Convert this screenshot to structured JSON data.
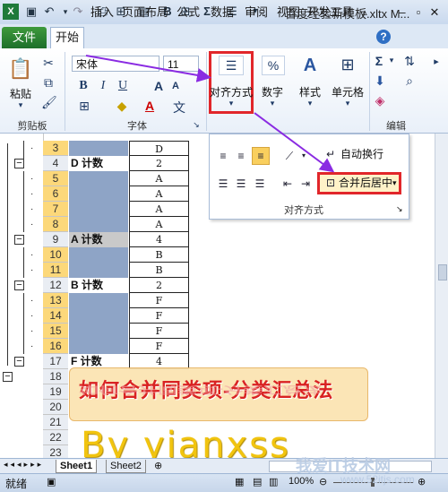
{
  "window": {
    "title": "百度经验新模板.xltx M..."
  },
  "tabs": [
    "文件",
    "开始",
    "插入",
    "页面布局",
    "公式",
    "数据",
    "审阅",
    "视图",
    "开发工具"
  ],
  "clipboard": {
    "paste_label": "粘贴",
    "group_label": "剪贴板"
  },
  "font": {
    "name": "宋体",
    "size": "11",
    "bold": "B",
    "italic": "I",
    "underline": "U",
    "group_label": "字体",
    "grow": "A",
    "shrink": "A",
    "fontcolor": "A",
    "wen": "文"
  },
  "alignment": {
    "label": "对齐方式"
  },
  "number": {
    "label": "数字",
    "percent": "%"
  },
  "styles": {
    "label": "样式"
  },
  "cells": {
    "label": "单元格"
  },
  "editing": {
    "group_label": "编辑",
    "sigma": "Σ"
  },
  "align_panel": {
    "wrap_text": "自动换行",
    "merge_center": "合并后居中",
    "group_label": "对齐方式"
  },
  "rows": [
    {
      "num": "3",
      "a": "",
      "b": "D",
      "a_fill": "blue",
      "sel": true
    },
    {
      "num": "4",
      "a": "D 计数",
      "b": "2",
      "a_fill": "white",
      "sel": false
    },
    {
      "num": "5",
      "a": "",
      "b": "A",
      "a_fill": "blue",
      "sel": true
    },
    {
      "num": "6",
      "a": "",
      "b": "A",
      "a_fill": "blue",
      "sel": true
    },
    {
      "num": "7",
      "a": "",
      "b": "A",
      "a_fill": "blue",
      "sel": true
    },
    {
      "num": "8",
      "a": "",
      "b": "A",
      "a_fill": "blue",
      "sel": true
    },
    {
      "num": "9",
      "a": "A 计数",
      "b": "4",
      "a_fill": "gray",
      "sel": false
    },
    {
      "num": "10",
      "a": "",
      "b": "B",
      "a_fill": "blue",
      "sel": true
    },
    {
      "num": "11",
      "a": "",
      "b": "B",
      "a_fill": "blue",
      "sel": true
    },
    {
      "num": "12",
      "a": "B 计数",
      "b": "2",
      "a_fill": "white",
      "sel": false
    },
    {
      "num": "13",
      "a": "",
      "b": "F",
      "a_fill": "blue",
      "sel": true
    },
    {
      "num": "14",
      "a": "",
      "b": "F",
      "a_fill": "blue",
      "sel": true
    },
    {
      "num": "15",
      "a": "",
      "b": "F",
      "a_fill": "blue",
      "sel": true
    },
    {
      "num": "16",
      "a": "",
      "b": "F",
      "a_fill": "blue",
      "sel": true
    },
    {
      "num": "17",
      "a": "F 计数",
      "b": "4",
      "a_fill": "white",
      "sel": false
    },
    {
      "num": "18",
      "a": "",
      "b": "",
      "a_fill": "white",
      "sel": false
    },
    {
      "num": "19",
      "a": "",
      "b": "",
      "a_fill": "white",
      "sel": false
    },
    {
      "num": "20",
      "a": "",
      "b": "",
      "a_fill": "white",
      "sel": false
    },
    {
      "num": "21",
      "a": "",
      "b": "",
      "a_fill": "white",
      "sel": false
    },
    {
      "num": "22",
      "a": "",
      "b": "",
      "a_fill": "white",
      "sel": false
    },
    {
      "num": "23",
      "a": "",
      "b": "",
      "a_fill": "white",
      "sel": false
    }
  ],
  "banner": {
    "title": "如何合并同类项-分类汇总法",
    "author": "By yianxss"
  },
  "sheets": [
    "Sheet1",
    "Sheet2"
  ],
  "status": {
    "ready": "就绪",
    "zoom": "100%"
  },
  "watermark": {
    "text": "我爱IT技术网",
    "url": "www.52itjs.com"
  }
}
